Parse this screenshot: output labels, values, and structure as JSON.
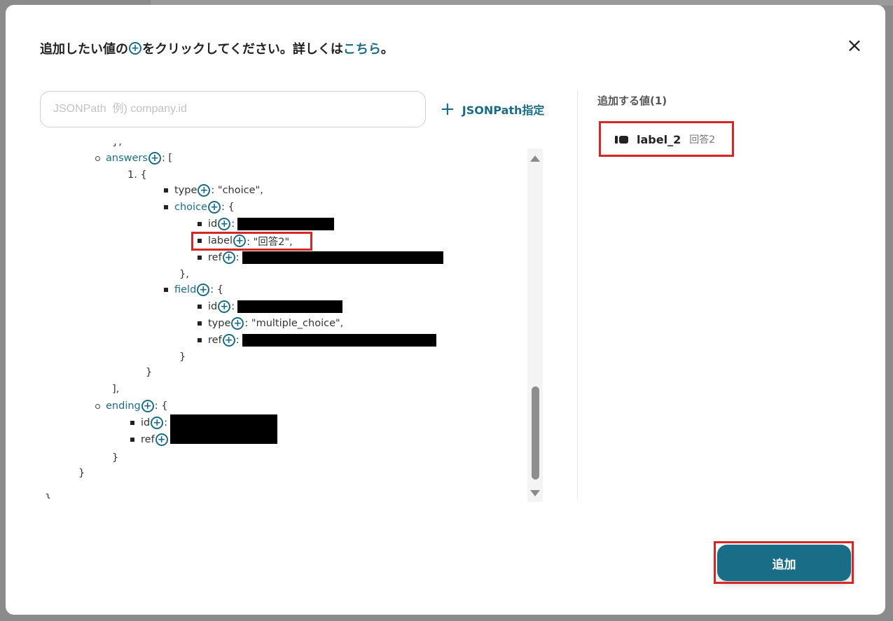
{
  "dialog": {
    "title_before": "追加したい値の",
    "title_after": "をクリックしてください。詳しくは",
    "title_link": "こちら",
    "title_end": "。",
    "close_icon": "×"
  },
  "search": {
    "placeholder": "JSONPath  例) company.id",
    "value": ""
  },
  "jsonpath_button": {
    "icon": "+",
    "label": "JSONPath指定"
  },
  "tree": {
    "plus_icon": "+",
    "top_partial": "},",
    "answers_key": "answers",
    "answers_suffix": ": [",
    "item_index": "1. {",
    "type_key": "type",
    "type_value": ": \"choice\",",
    "choice_key": "choice",
    "choice_suffix": ": {",
    "choice_id_key": "id",
    "colon": ":",
    "choice_label_key": "label",
    "choice_label_value": ": \"回答2\",",
    "choice_ref_key": "ref",
    "close_brace_comma": "},",
    "field_key": "field",
    "field_suffix": ": {",
    "field_id_key": "id",
    "field_type_key": "type",
    "field_type_value": ": \"multiple_choice\",",
    "field_ref_key": "ref",
    "close_brace": "}",
    "close_bracket_comma": "],",
    "ending_key": "ending",
    "ending_suffix": ": {",
    "ending_id_key": "id",
    "ending_ref_key": "ref",
    "bottom_partial": "}"
  },
  "right_panel": {
    "title": "追加する値(1)",
    "items": [
      {
        "label": "label_2",
        "value": "回答2"
      }
    ]
  },
  "footer": {
    "add_button": "追加"
  },
  "colors": {
    "accent": "#1a6d86",
    "highlight": "#d62626"
  }
}
